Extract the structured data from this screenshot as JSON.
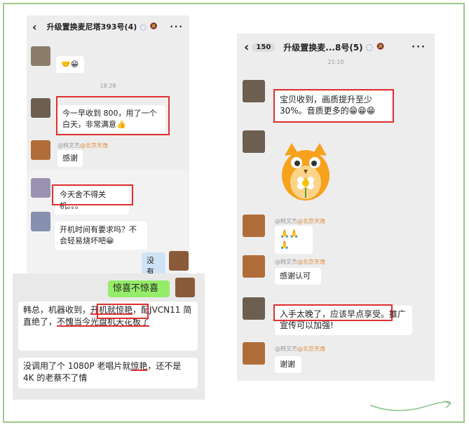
{
  "left_chat": {
    "title": "升级置换麦尼塔393号(4)",
    "menu": "···",
    "emoji_reply": "🤝😁",
    "time": "18:28",
    "msg_800": "今一早收到 800，用了一个白天，非常满意👍",
    "sender_name": "@韩文杰",
    "sender_loc": "@北京天逸",
    "msg_thanks": "感谢",
    "msg_reluctant": "今天舍不得关机。。。",
    "msg_question": "开机时间有要求吗？不会轻易烧坏吧😁",
    "msg_reply": "没有"
  },
  "left_lower": {
    "msg_green": "惊喜不惊喜",
    "msg_p1": "韩总，机器收到，",
    "msg_p1_u": "开机就惊艳",
    "msg_p1_c": "，配JVCN11 简直绝了，",
    "msg_p1_u2": "不愧当今光盘机天花板了",
    "msg_p2_a": "没调用了个 1080P 老唱片就",
    "msg_p2_u": "惊艳",
    "msg_p2_b": "，还不是 4K 的老蔡不了情"
  },
  "right_chat": {
    "back_count": "150",
    "title": "升级置换麦...8号(5)",
    "menu": "···",
    "time": "21:10",
    "msg_quality": "宝贝收到，画质提升至少 30%。音质更多的😁😁😁",
    "sender_name": "@韩文杰",
    "sender_loc": "@北京天逸",
    "msg_clap": "🙏🙏🙏",
    "msg_thanks": "感谢认可",
    "msg_late": "入手太晚了，应该早点享受。推广宣传可以加强!",
    "msg_thanks2": "谢谢"
  },
  "colors": {
    "accent_red": "#e03030",
    "wechat_green": "#95ec69",
    "frame_green": "#9cc98a",
    "bg": "#ededed"
  }
}
